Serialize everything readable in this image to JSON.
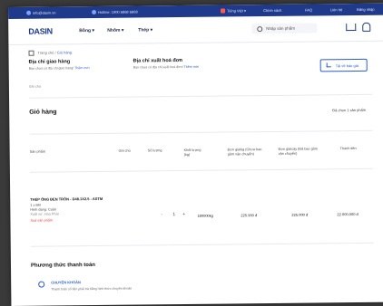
{
  "topbar": {
    "email": "info@dasin.vn",
    "hotline": "Hotline: 1900 6868 6868",
    "lang": "Tiếng Việt",
    "link1": "Chính sách",
    "link2": "FAQ",
    "link3": "Liên hệ",
    "login": "Đăng nhập"
  },
  "header": {
    "logo_main": "DASIN",
    "logo_accent": "A",
    "nav": [
      "Bồng ▾",
      "Nhôm ▾",
      "Thép ▾"
    ],
    "search_placeholder": "Nhập sản phẩm"
  },
  "breadcrumb": {
    "home": "Trang chủ",
    "sep": " / ",
    "current": "Giỏ hàng"
  },
  "delivery": {
    "title": "Địa chỉ giao hàng",
    "desc": "Bạn chưa có địa chỉ giao hàng!",
    "link": "Thêm mới"
  },
  "invoice": {
    "title": "Địa chỉ xuất hoá đơn",
    "desc": "Bạn chưa có địa chỉ xuất hoá đơn!",
    "link": "Thêm mới"
  },
  "quote_button": "Tải về báo giá",
  "note_label": "Ghi chú",
  "cart": {
    "title": "Giỏ hàng",
    "selected": "Đã chọn 1 sản phẩm",
    "headers": [
      "Sản phẩm",
      "Ghi chú",
      "Số lượng",
      "Khối lượng (kg)",
      "Đơn giá/kg (Chưa bao gồm vận chuyển)",
      "Đơn giá/cây (Đã bao gồm vận chuyển)",
      "Thành tiền"
    ],
    "item": {
      "name": "THÉP ỐNG ĐEN TRÒN - D48.1X2.5 - ASTM",
      "line1": "1 x 6M",
      "line2": "Hình dạng: Cuộn",
      "line3": "Xuất xứ: Hòa Phát",
      "remove": "Xoá sản phẩm",
      "qty_minus": "-",
      "qty": "1",
      "qty_plus": "+",
      "weight": "180000kg",
      "price_kg": "225.900 đ",
      "price_bar": "225.000 đ",
      "total": "22.000.000 đ"
    }
  },
  "payment": {
    "title": "Phương thức thanh toán",
    "option": "CHUYỂN KHOẢN",
    "desc": "Thanh toán số tiền phải trả bằng hình thức chuyển khoản"
  }
}
